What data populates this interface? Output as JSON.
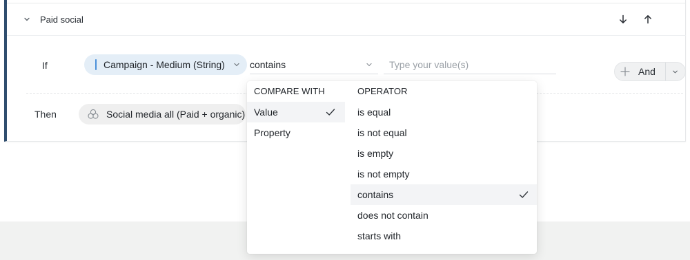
{
  "rule": {
    "title": "Paid social",
    "if_label": "If",
    "then_label": "Then",
    "property": "Campaign - Medium (String)",
    "operator": "contains",
    "value_placeholder": "Type your value(s)",
    "segment": "Social media all (Paid + organic)",
    "and_label": "And"
  },
  "dropdown": {
    "compare_header": "COMPARE WITH",
    "operator_header": "OPERATOR",
    "compare_options": [
      {
        "label": "Value",
        "selected": true
      },
      {
        "label": "Property",
        "selected": false
      }
    ],
    "operator_options": [
      {
        "label": "is equal",
        "selected": false
      },
      {
        "label": "is not equal",
        "selected": false
      },
      {
        "label": "is empty",
        "selected": false
      },
      {
        "label": "is not empty",
        "selected": false
      },
      {
        "label": "contains",
        "selected": true
      },
      {
        "label": "does not contain",
        "selected": false
      },
      {
        "label": "starts with",
        "selected": false
      }
    ]
  },
  "icons": {
    "collapse": "chevron-down-icon",
    "move_down": "arrow-down-icon",
    "move_up": "arrow-up-icon",
    "segment": "segment-circles-icon",
    "add": "plus-icon",
    "check": "check-icon"
  },
  "colors": {
    "accent_bar": "#2f4d6e",
    "property_pill": "#e4eef7",
    "property_marker": "#4a90d9",
    "selected_row": "#f3f4f6"
  }
}
